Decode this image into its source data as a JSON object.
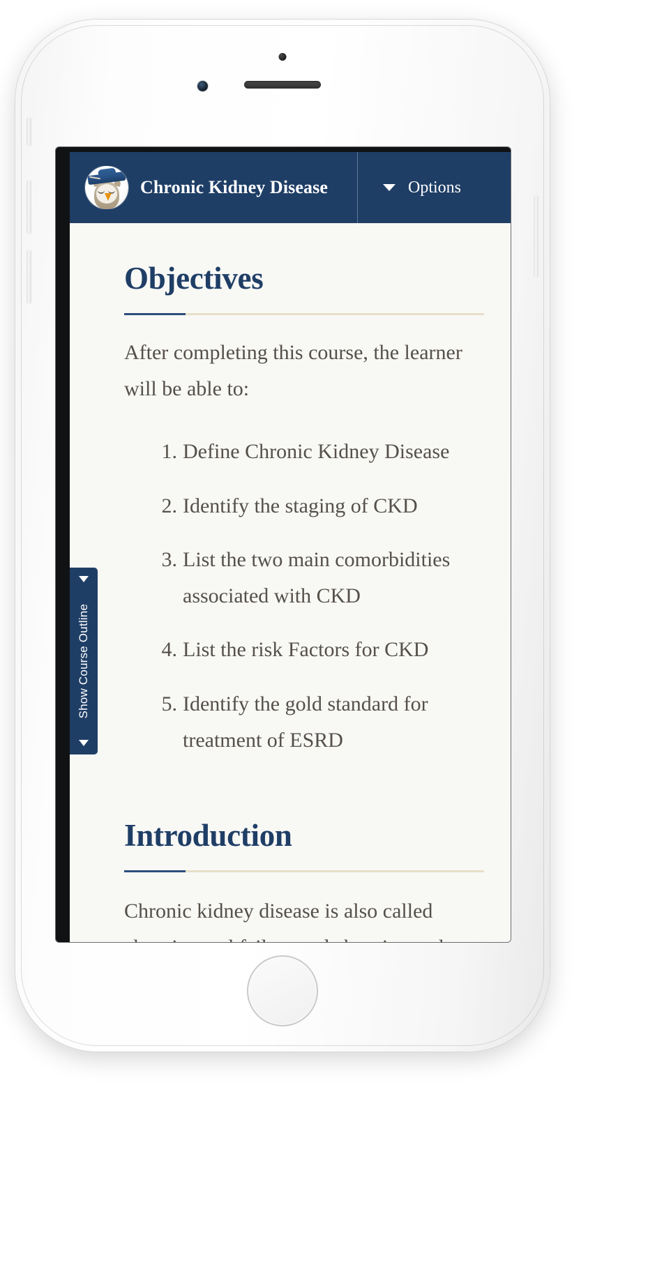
{
  "device": {
    "name": "smartphone-mockup",
    "parts": {
      "front_camera": "front-camera",
      "earpiece": "earpiece-speaker",
      "proximity_sensor": "proximity-sensor",
      "home_button": "home-button",
      "silent_switch": "silent-switch",
      "volume_up": "volume-up-button",
      "volume_down": "volume-down-button",
      "power_button": "power-button"
    }
  },
  "colors": {
    "header_navy": "#1F3E66",
    "heading_navy": "#1F3E66",
    "rule_accent": "#2C4F7C",
    "rule_tan": "#E7DFC9",
    "page_background": "#F8F8F5",
    "body_text": "#55504A"
  },
  "header": {
    "logo_icon": "owl-graduation-cap-logo",
    "title": "Chronic Kidney Disease",
    "options_label": "Options",
    "options_caret_icon": "caret-down-icon"
  },
  "outline_tab": {
    "label": "Show Course Outline",
    "top_caret_icon": "caret-up-icon",
    "bottom_caret_icon": "caret-down-icon"
  },
  "content": {
    "objectives": {
      "heading": "Objectives",
      "intro": "After completing this course, the learner will be able to:",
      "items": [
        {
          "marker": "1.",
          "text": "Define Chronic Kidney Disease"
        },
        {
          "marker": "2.",
          "text": "Identify the staging of CKD"
        },
        {
          "marker": "3.",
          "text": "List the two main comorbidities associated with CKD"
        },
        {
          "marker": "4.",
          "text": "List the risk Factors for CKD"
        },
        {
          "marker": "5.",
          "text": "Identify the gold standard for treatment of ESRD"
        }
      ]
    },
    "introduction": {
      "heading": "Introduction",
      "paragraph": "Chronic kidney disease is also called chronic renal failure and chronic renal insufficiency. If the disease is severe"
    }
  }
}
